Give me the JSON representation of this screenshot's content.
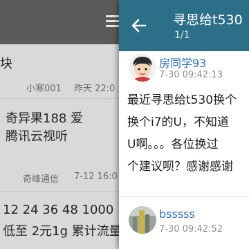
{
  "left_pane": {
    "items": [
      {
        "fragment": "块",
        "author": "小寒001",
        "time": "昨天 22:0"
      },
      {
        "line1": "奇异果188 爱",
        "line2": "腾讯云视听",
        "author": "奇峰通信",
        "time": "7-12 16:0"
      },
      {
        "line1": "12 24 36 48 1000",
        "line2": "低至 2元1g 累计流量"
      }
    ]
  },
  "thread": {
    "title": "寻思给t530",
    "page_indicator": "1/1",
    "posts": [
      {
        "username": "房同学93",
        "time": "7-30 09:42:13",
        "lines": [
          "最近寻思给t530换个",
          "换个i7的U，不知道",
          "U啊。。。各位换过",
          "个建议呗？感谢感谢"
        ]
      },
      {
        "username": "bsssss",
        "time": "7-30 09:42:52"
      }
    ]
  },
  "colors": {
    "thread_header": "#2d6f88",
    "username": "#2f70c9",
    "left_header": "#5a5a5a"
  },
  "icons": {
    "back": "arrow-left-icon",
    "menu": "hamburger-menu-icon"
  }
}
